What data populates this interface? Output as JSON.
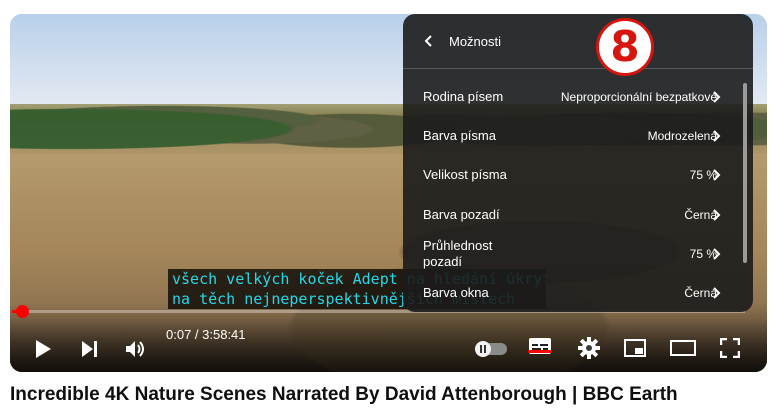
{
  "video": {
    "title": "Incredible 4K Nature Scenes Narrated By David Attenborough | BBC Earth",
    "subtitles": [
      "všech velkých koček Adept na hledání úkrytu",
      "na těch nejneperspektivnějších místech"
    ],
    "time_display": "0:07 / 3:58:41",
    "progress_fraction": 0.0005
  },
  "menu": {
    "title": "Možnosti",
    "items": [
      {
        "label": "Rodina písem",
        "value": "Neproporcionální bezpatkové"
      },
      {
        "label": "Barva písma",
        "value": "Modrozelená"
      },
      {
        "label": "Velikost písma",
        "value": "75 %"
      },
      {
        "label": "Barva pozadí",
        "value": "Černá"
      },
      {
        "label": "Průhlednost pozadí",
        "value": "75 %"
      },
      {
        "label": "Barva okna",
        "value": "Černá"
      }
    ]
  },
  "badge": {
    "number": "8",
    "color": "#d6150f"
  },
  "colors": {
    "progress": "#ff0000",
    "subtitle_text": "#26d7e6"
  },
  "icons": [
    "play-icon",
    "next-icon",
    "volume-icon",
    "autoplay-toggle-icon",
    "subtitles-icon",
    "settings-icon",
    "miniplayer-icon",
    "theater-icon",
    "fullscreen-icon",
    "back-chevron-icon",
    "chevron-right-icon"
  ]
}
